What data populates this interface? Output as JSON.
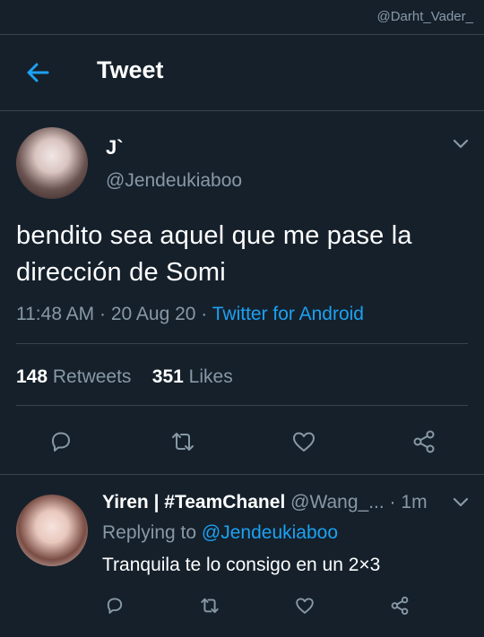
{
  "watermark": "@Darht_Vader_",
  "header": {
    "title": "Tweet"
  },
  "tweet": {
    "display_name": "J`",
    "handle": "@Jendeukiaboo",
    "text": "bendito sea aquel que me pase la dirección de Somi",
    "time": "11:48 AM",
    "date": "20 Aug 20",
    "source": "Twitter for Android",
    "retweets_count": "148",
    "retweets_label": "Retweets",
    "likes_count": "351",
    "likes_label": "Likes"
  },
  "reply": {
    "display_name": "Yiren | #TeamChanel",
    "handle": "@Wang_...",
    "time": "1m",
    "replying_prefix": "Replying to",
    "replying_to": "@Jendeukiaboo",
    "text": "Tranquila te lo consigo en un 2×3"
  },
  "colors": {
    "background": "#15202b",
    "muted": "#8899a6",
    "accent": "#1da1f2",
    "divider": "#38444d"
  },
  "icons": {
    "back": "arrow-left-icon",
    "more": "chevron-down-icon",
    "reply": "reply-icon",
    "retweet": "retweet-icon",
    "like": "heart-icon",
    "share": "share-icon"
  }
}
